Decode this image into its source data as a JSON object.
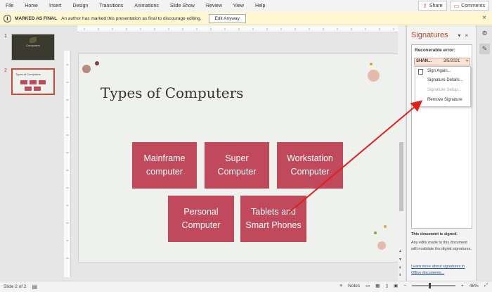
{
  "menu": [
    "File",
    "Home",
    "Insert",
    "Design",
    "Transitions",
    "Animations",
    "Slide Show",
    "Review",
    "View",
    "Help"
  ],
  "toolbar_right": {
    "share": "Share",
    "comments": "Comments"
  },
  "final_bar": {
    "label": "MARKED AS FINAL",
    "message": "An author has marked this presentation as final to discourage editing.",
    "button": "Edit Anyway"
  },
  "thumbnails": [
    {
      "number": "1",
      "title": "Computers"
    },
    {
      "number": "2",
      "title": "Types of Computers"
    }
  ],
  "slide": {
    "title": "Types of Computers",
    "boxes": [
      "Mainframe\ncomputer",
      "Super\nComputer",
      "Workstation\nComputer",
      "Personal\nComputer",
      "Tablets and\nSmart Phones"
    ],
    "box_color": "#c04a5c",
    "background": "#eff1ed"
  },
  "signatures_pane": {
    "title": "Signatures",
    "recoverable_error": "Recoverable error:",
    "entry": {
      "name": "SHAN...",
      "date": "3/5/2021"
    },
    "context_menu": [
      {
        "label": "Sign Again...",
        "enabled": true
      },
      {
        "label": "Signature Details...",
        "enabled": true
      },
      {
        "label": "Signature Setup...",
        "enabled": false
      },
      {
        "label": "Remove Signature",
        "enabled": true
      }
    ],
    "signed_heading": "This document is signed.",
    "signed_desc": "Any edits made to this document will invalidate the digital signatures.",
    "learn_link": "Learn more about signatures in Office documents..."
  },
  "status": {
    "slide": "Slide 2 of 2",
    "notes": "Notes",
    "zoom": "48%"
  },
  "colors": {
    "accent": "#b7472a",
    "arrow": "#e0201c"
  },
  "icons": [
    "info-icon",
    "close-icon",
    "share-icon",
    "comment-icon",
    "signature-icon",
    "notes-icon",
    "normal-view-icon",
    "slide-sorter-icon",
    "reading-view-icon",
    "fit-slide-icon"
  ]
}
